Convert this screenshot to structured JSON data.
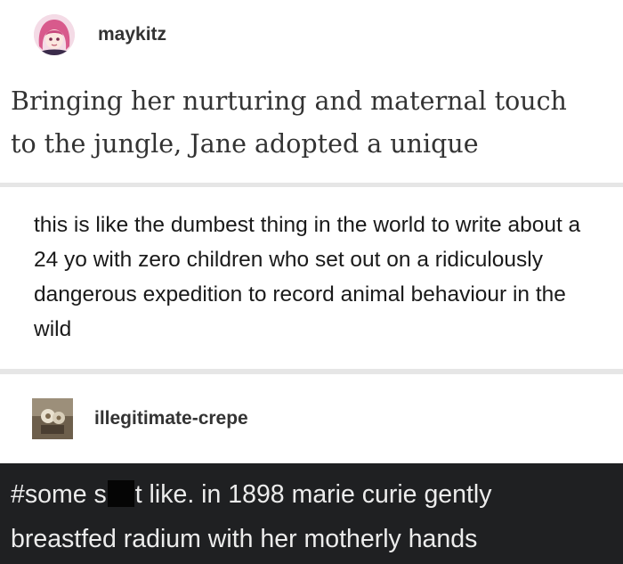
{
  "post": {
    "author": "maykitz",
    "quote_line1": "Bringing her nurturing and maternal touch",
    "quote_line2": "to the jungle, Jane adopted a unique"
  },
  "comment": {
    "text": "this is like the dumbest thing in the world to write about a 24 yo with zero children who set out on a ridiculously dangerous expedition to record animal behaviour in the wild"
  },
  "reblog": {
    "author": "illegitimate-crepe",
    "tags_line1_before": "#some s",
    "tags_line1_after": "t like. in 1898 marie curie gently",
    "tags_line2": "breastfed radium with her motherly hands"
  },
  "colors": {
    "page_gap": "#e6e6e6",
    "card": "#ffffff",
    "dark_background": "#1f2022",
    "dark_text": "#ececec",
    "censor_bar": "#050505"
  },
  "icons": {
    "avatar_1": "anime-girl-avatar",
    "avatar_2": "photo-avatar"
  }
}
